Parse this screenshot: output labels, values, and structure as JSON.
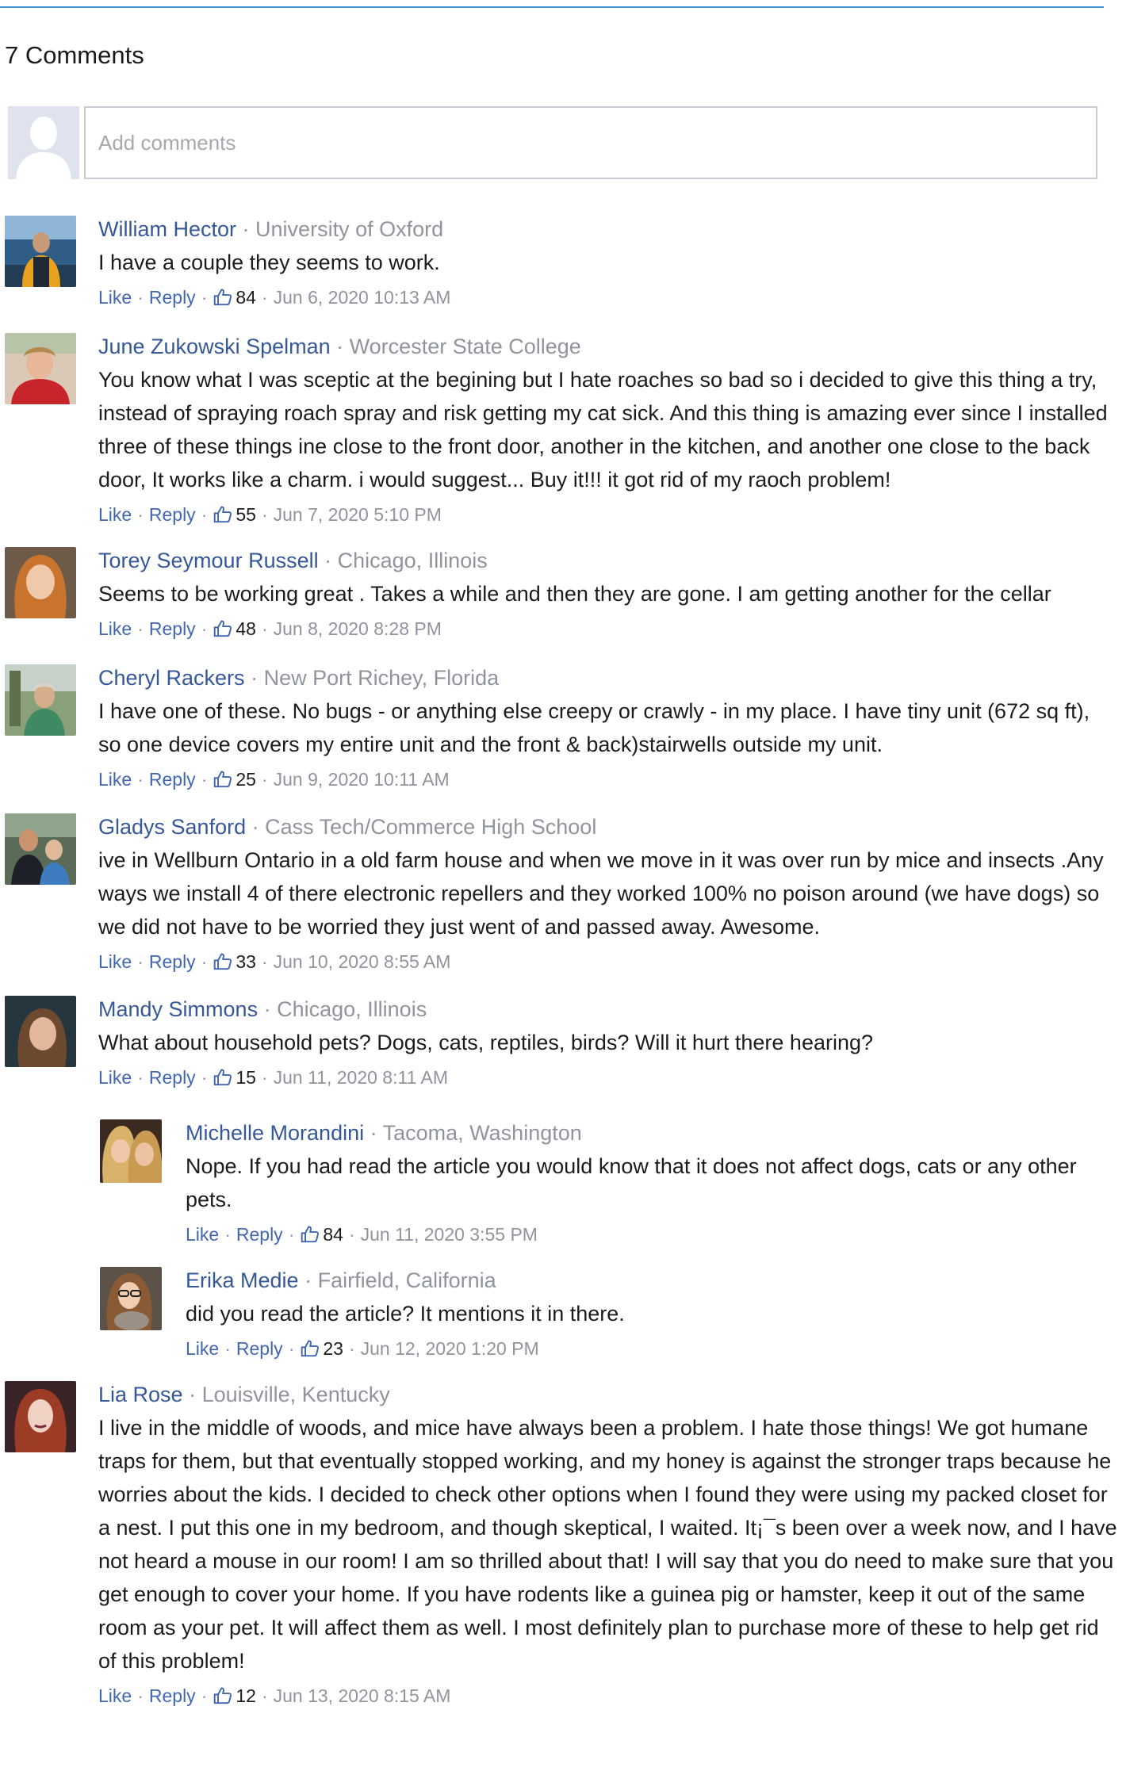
{
  "header": {
    "comment_count": "7 Comments"
  },
  "composer": {
    "placeholder": "Add comments"
  },
  "actions": {
    "like_label": "Like",
    "reply_label": "Reply",
    "separator": "·"
  },
  "colors": {
    "accent_rule": "#3b8fd6",
    "author_link": "#365899",
    "action_link": "#4267b2",
    "meta_gray": "#90949c"
  },
  "comments": [
    {
      "author": "William Hector",
      "affiliation": "University of Oxford",
      "text": "I have a couple they seems to work.",
      "likes": "84",
      "time": "Jun 6, 2020 10:13 AM"
    },
    {
      "author": "June Zukowski Spelman",
      "affiliation": "Worcester State College",
      "text": "You know what I was sceptic at the begining but I hate roaches so bad so i decided to give this thing a try, instead of spraying roach spray and risk getting my cat sick. And this thing is amazing ever since I installed three of these things ine close to the front door, another in the kitchen, and another one close to the back door, It works like a charm. i would suggest... Buy it!!! it got rid of my raoch problem!",
      "likes": "55",
      "time": "Jun 7, 2020 5:10 PM"
    },
    {
      "author": "Torey Seymour Russell",
      "affiliation": "Chicago, Illinois",
      "text": "Seems to be working great . Takes a while and then they are gone. I am getting another for the cellar",
      "likes": "48",
      "time": "Jun 8, 2020 8:28 PM"
    },
    {
      "author": "Cheryl Rackers",
      "affiliation": "New Port Richey, Florida",
      "text": "I have one of these. No bugs - or anything else creepy or crawly - in my place. I have tiny unit (672 sq ft), so one device covers my entire unit and the front & back)stairwells outside my unit.",
      "likes": "25",
      "time": "Jun 9, 2020 10:11 AM"
    },
    {
      "author": "Gladys Sanford",
      "affiliation": "Cass Tech/Commerce High School",
      "text": "ive in Wellburn Ontario in a old farm house and when we move in it was over run by mice and insects .Any ways we install 4 of there electronic repellers and they worked 100% no poison around (we have dogs) so we did not have to be worried they just went of and passed away. Awesome.",
      "likes": "33",
      "time": "Jun 10, 2020 8:55 AM"
    },
    {
      "author": "Mandy Simmons",
      "affiliation": "Chicago, Illinois",
      "text": "What about household pets? Dogs, cats, reptiles, birds? Will it hurt there hearing?",
      "likes": "15",
      "time": "Jun 11, 2020 8:11 AM"
    },
    {
      "author": "Lia Rose",
      "affiliation": "Louisville, Kentucky",
      "text": "I live in the middle of woods, and mice have always been a problem. I hate those things! We got humane traps for them, but that eventually stopped working, and my honey is against the stronger traps because he worries about the kids. I decided to check other options when I found they were using my packed closet for a nest. I put this one in my bedroom, and though skeptical, I waited. It¡¯s been over a week now, and I have not heard a mouse in our room! I am so thrilled about that! I will say that you do need to make sure that you get enough to cover your home. If you have rodents like a guinea pig or hamster, keep it out of the same room as your pet. It will affect them as well. I most definitely plan to purchase more of these to help get rid of this problem!",
      "likes": "12",
      "time": "Jun 13, 2020 8:15 AM"
    }
  ],
  "replies": [
    {
      "author": "Michelle Morandini",
      "affiliation": "Tacoma, Washington",
      "text": "Nope. If you had read the article you would know that it does not affect dogs, cats or any other pets.",
      "likes": "84",
      "time": "Jun 11, 2020 3:55 PM"
    },
    {
      "author": "Erika Medie",
      "affiliation": "Fairfield, California",
      "text": "did you read the article? It mentions it in there.",
      "likes": "23",
      "time": "Jun 12, 2020 1:20 PM"
    }
  ]
}
